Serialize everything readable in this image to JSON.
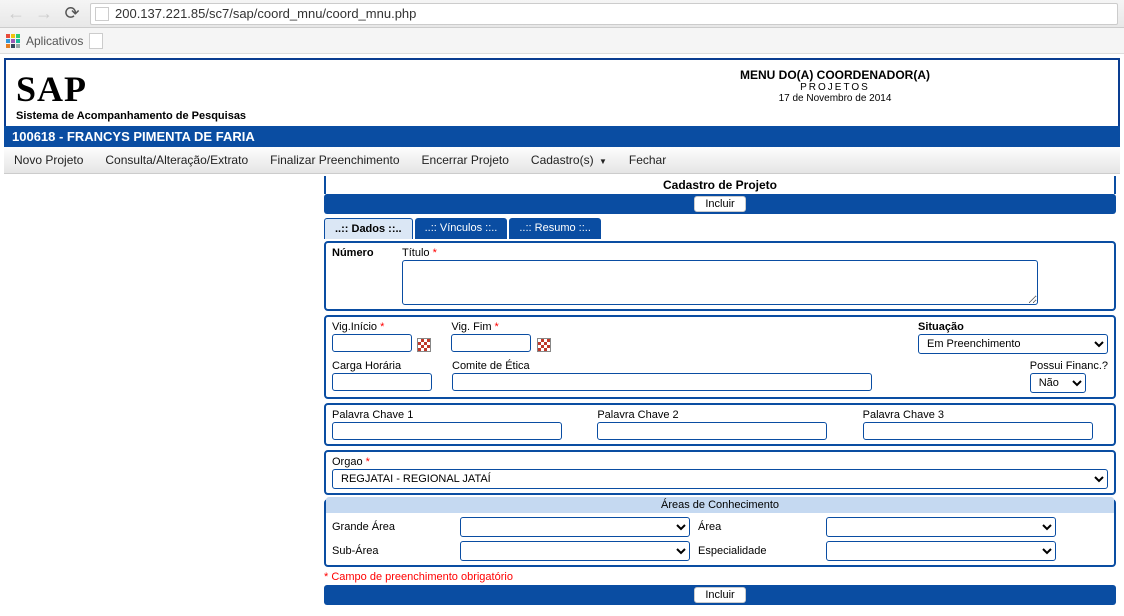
{
  "browser": {
    "url": "200.137.221.85/sc7/sap/coord_mnu/coord_mnu.php",
    "apps_label": "Aplicativos"
  },
  "header": {
    "logo": "SAP",
    "logo_sub": "Sistema de Acompanhamento de Pesquisas",
    "menu_title": "MENU DO(A) COORDENADOR(A)",
    "menu_sub": "PROJETOS",
    "menu_date": "17 de Novembro de 2014"
  },
  "userbar": "100618 - FRANCYS PIMENTA DE FARIA",
  "menu": {
    "novo": "Novo Projeto",
    "consulta": "Consulta/Alteração/Extrato",
    "finalizar": "Finalizar Preenchimento",
    "encerrar": "Encerrar Projeto",
    "cadastros": "Cadastro(s)",
    "fechar": "Fechar"
  },
  "panel": {
    "title": "Cadastro de Projeto",
    "incluir": "Incluir"
  },
  "tabs": {
    "dados": "..:: Dados ::..",
    "vinculos": "..:: Vínculos ::..",
    "resumo": "..:: Resumo ::.."
  },
  "form": {
    "numero": "Número",
    "titulo": "Título",
    "vig_inicio": "Vig.Início",
    "vig_fim": "Vig. Fim",
    "situacao": "Situação",
    "situacao_value": "Em Preenchimento",
    "carga": "Carga Horária",
    "comite": "Comite de Ética",
    "financ": "Possui Financ.?",
    "financ_value": "Não",
    "pc1": "Palavra Chave 1",
    "pc2": "Palavra Chave 2",
    "pc3": "Palavra Chave 3",
    "orgao": "Orgao",
    "orgao_value": "REGJATAI - REGIONAL JATAÍ",
    "areas_title": "Áreas de Conhecimento",
    "grande_area": "Grande Área",
    "area": "Área",
    "sub_area": "Sub-Área",
    "especialidade": "Especialidade"
  },
  "footnote": "* Campo de preenchimento obrigatório"
}
